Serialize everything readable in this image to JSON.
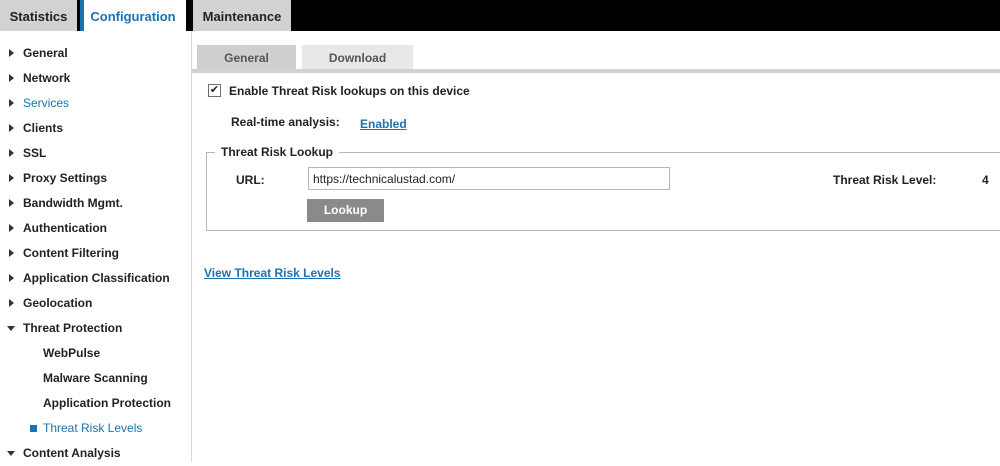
{
  "top_tabs": [
    {
      "label": "Statistics"
    },
    {
      "label": "Configuration"
    },
    {
      "label": "Maintenance"
    }
  ],
  "sidebar": {
    "items": [
      {
        "label": "General"
      },
      {
        "label": "Network"
      },
      {
        "label": "Services"
      },
      {
        "label": "Clients"
      },
      {
        "label": "SSL"
      },
      {
        "label": "Proxy Settings"
      },
      {
        "label": "Bandwidth Mgmt."
      },
      {
        "label": "Authentication"
      },
      {
        "label": "Content Filtering"
      },
      {
        "label": "Application Classification"
      },
      {
        "label": "Geolocation"
      },
      {
        "label": "Threat Protection"
      },
      {
        "label": "WebPulse"
      },
      {
        "label": "Malware Scanning"
      },
      {
        "label": "Application Protection"
      },
      {
        "label": "Threat Risk Levels"
      },
      {
        "label": "Content Analysis"
      }
    ]
  },
  "sub_tabs": [
    {
      "label": "General"
    },
    {
      "label": "Download"
    }
  ],
  "settings": {
    "enable_label": "Enable Threat Risk lookups on this device",
    "enable_check": "✔",
    "realtime_label": "Real-time analysis:",
    "realtime_value": "Enabled"
  },
  "lookup": {
    "legend": "Threat Risk Lookup",
    "url_label": "URL:",
    "url_value": "https://technicalustad.com/",
    "button_label": "Lookup",
    "level_label": "Threat Risk Level:",
    "level_value": "4"
  },
  "links": {
    "view_levels": "View Threat Risk Levels"
  },
  "colors": {
    "accent": "#1a73b0",
    "topbar": "#000000",
    "tab_inactive": "#d2d2d2",
    "button": "#8a8a8a"
  }
}
